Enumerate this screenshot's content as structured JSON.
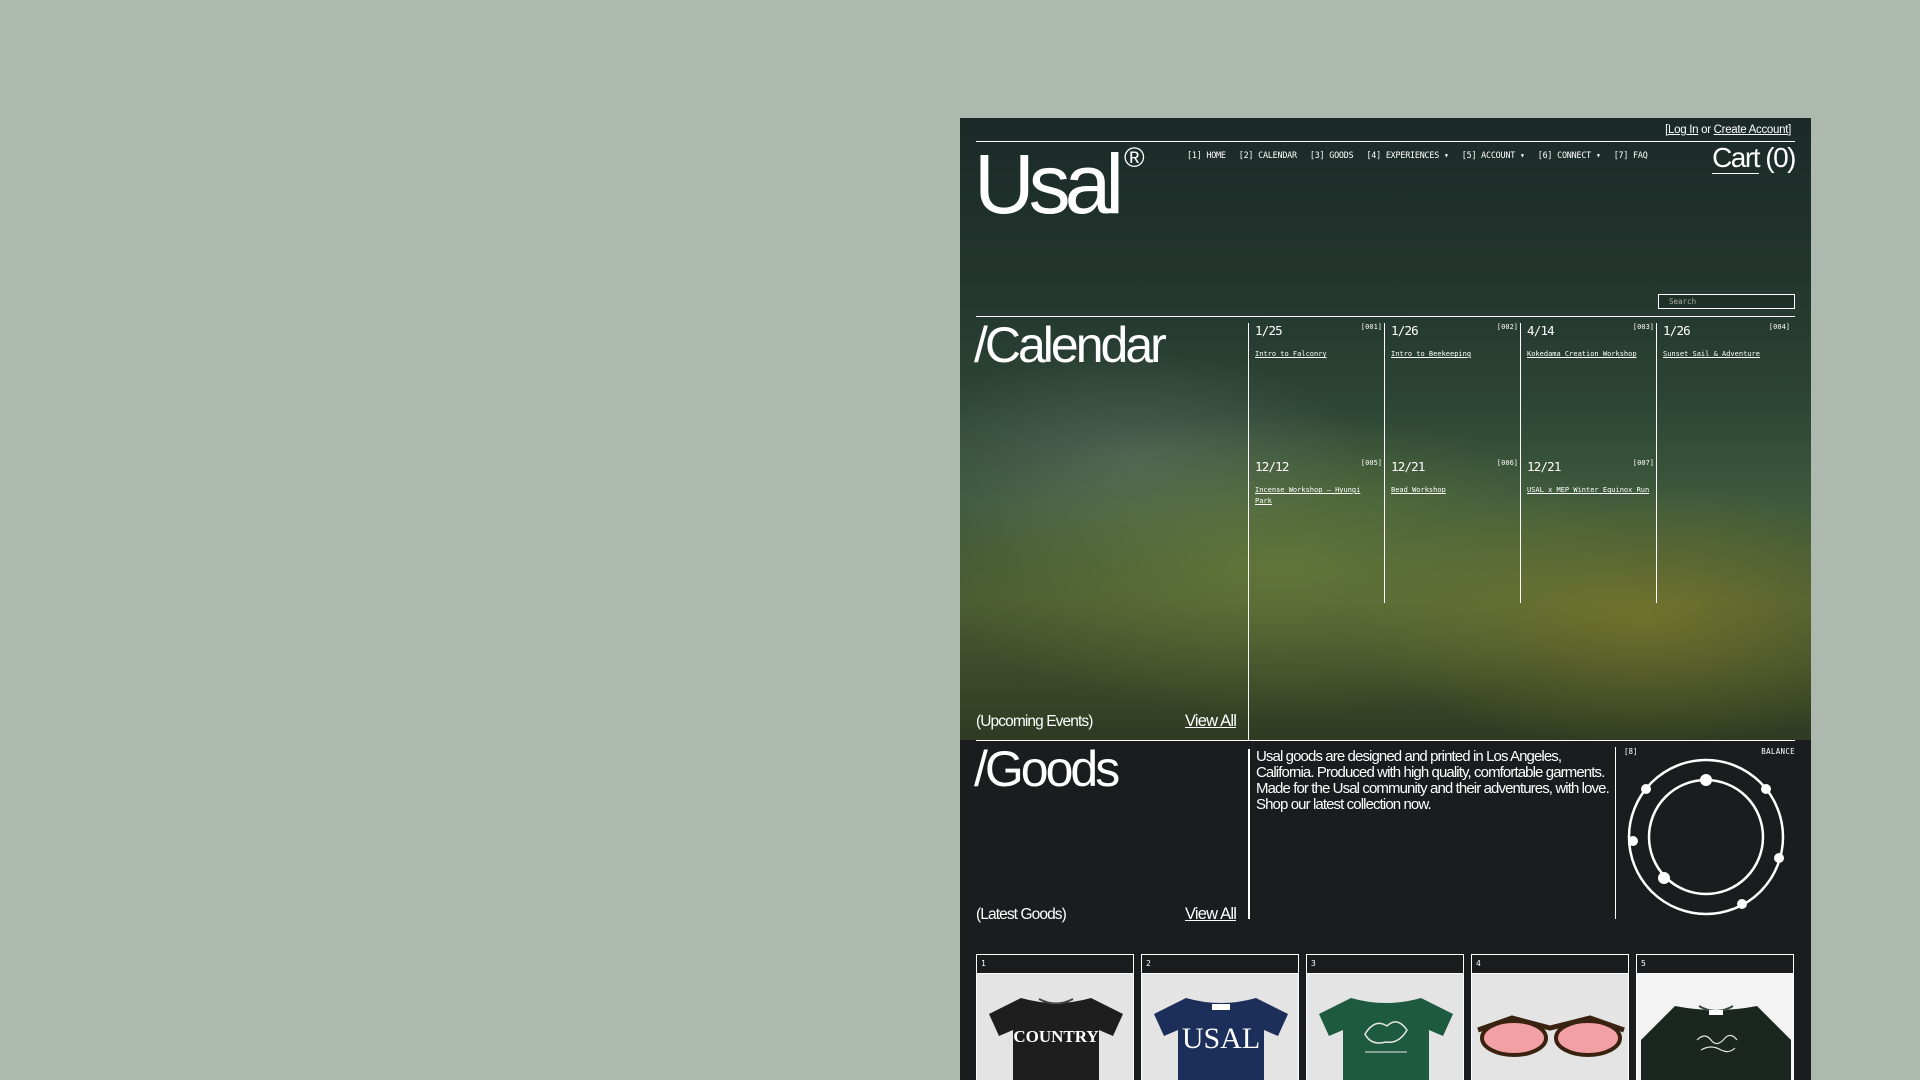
{
  "header": {
    "login": "Log In",
    "or": "or",
    "create_account": "Create Account",
    "open_bracket": "[",
    "close_bracket": "]",
    "logo": "Usal",
    "logo_mark": "®",
    "cart_label": "Cart",
    "cart_count": "(0)",
    "nav": [
      "[1] HOME",
      "[2] CALENDAR",
      "[3] GOODS",
      "[4] EXPERIENCES ▾",
      "[5] ACCOUNT ▾",
      "[6] CONNECT ▾",
      "[7] FAQ"
    ],
    "search_placeholder": "Search"
  },
  "calendar": {
    "title": "/Calendar",
    "subtitle": "(Upcoming Events)",
    "view_all": "View All",
    "events": [
      {
        "date": "1/25",
        "num": "[001]",
        "name": "Intro to Falconry"
      },
      {
        "date": "1/26",
        "num": "[002]",
        "name": "Intro to Beekeeping"
      },
      {
        "date": "4/14",
        "num": "[003]",
        "name": "Kokedama Creation Workshop"
      },
      {
        "date": "1/26",
        "num": "[004]",
        "name": "Sunset Sail & Adventure"
      },
      {
        "date": "12/12",
        "num": "[005]",
        "name": "Incense Workshop — Hyungi Park"
      },
      {
        "date": "12/21",
        "num": "[006]",
        "name": "Bead Workshop"
      },
      {
        "date": "12/21",
        "num": "[007]",
        "name": "USAL x MEP Winter Equinox Run"
      }
    ]
  },
  "goods": {
    "title": "/Goods",
    "subtitle": "(Latest Goods)",
    "view_all": "View All",
    "description": "Usal goods are designed and printed in Los Angeles, California. Produced with high quality, comfortable garments. Made for the Usal community and their adventures, with love. Shop our latest collection now.",
    "feature_num": "[8]",
    "feature_label": "BALANCE",
    "products": [
      {
        "num": "1",
        "print": "COUNTRY"
      },
      {
        "num": "2",
        "print": "USAL"
      },
      {
        "num": "3",
        "print": ""
      },
      {
        "num": "4",
        "print": ""
      },
      {
        "num": "5",
        "print": ""
      }
    ]
  },
  "colors": {
    "page_bg": "#adb8ae",
    "site_bg": "#1b1c1d",
    "text": "#ffffff",
    "tee_black": "#1e1e1e",
    "tee_navy": "#1c2e5a",
    "tee_green": "#1d5a40",
    "lens_pink": "#f2a0a4"
  }
}
